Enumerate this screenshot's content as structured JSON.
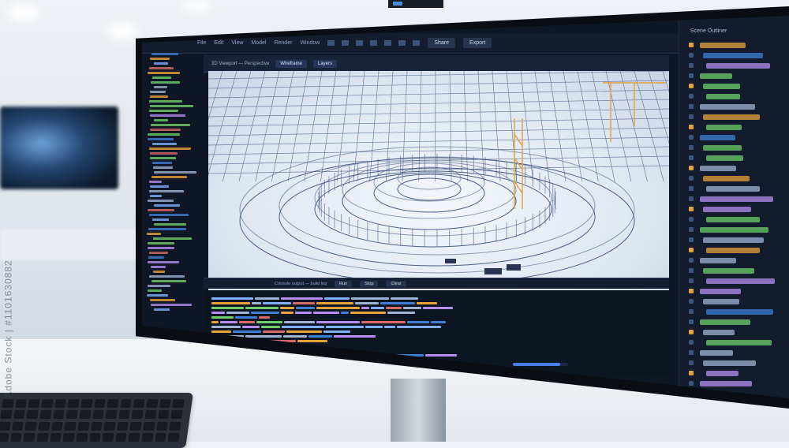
{
  "watermark": {
    "text": "Adobe Stock | #1101630882"
  },
  "app": {
    "menu_items": [
      "File",
      "Edit",
      "View",
      "Model",
      "Render",
      "Window"
    ],
    "top_buttons": [
      "Share",
      "Export"
    ]
  },
  "viewport": {
    "header_label": "3D Viewport — Perspective",
    "tabs": [
      "Wireframe",
      "Layers"
    ]
  },
  "console": {
    "header_text": "Console output — build log",
    "buttons": [
      "Run",
      "Stop",
      "Clear"
    ],
    "progress_fraction": 0.85
  },
  "right_panel": {
    "title": "Scene Outliner"
  },
  "colors": {
    "accent": "#4a7ee8",
    "warning": "#e3c22a",
    "structure": "#f0a23a",
    "code_green": "#6fcf6a",
    "code_purple": "#b68df0"
  }
}
